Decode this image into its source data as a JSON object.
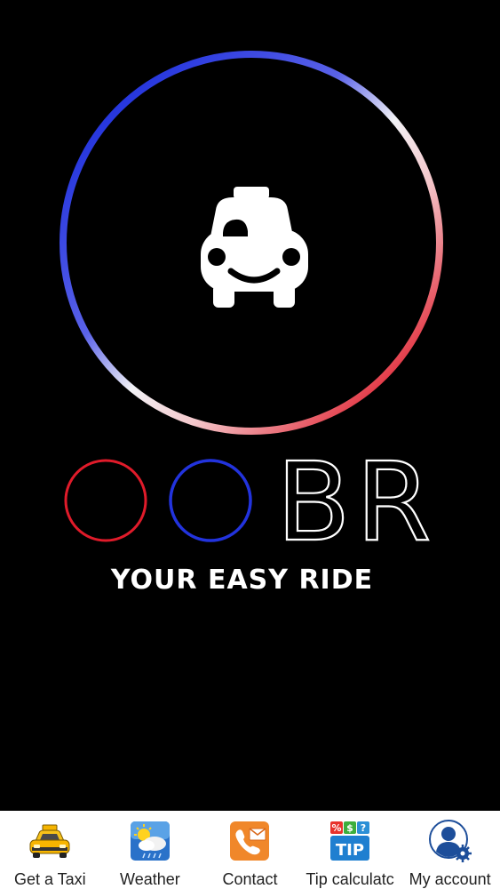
{
  "app": {
    "logo_letters": "BR",
    "slogan": "YOUR EASY RIDE"
  },
  "colors": {
    "background": "#000000",
    "ring_blue": "#2233dd",
    "ring_red": "#e01b2a",
    "logo_white": "#ffffff",
    "tabbar_background": "#ffffff"
  },
  "tabbar": {
    "items": [
      {
        "label": "Get a Taxi",
        "icon": "taxi-icon"
      },
      {
        "label": "Weather",
        "icon": "weather-icon"
      },
      {
        "label": "Contact",
        "icon": "contact-icon"
      },
      {
        "label": "Tip calculatc",
        "icon": "tip-calculator-icon"
      },
      {
        "label": "My account",
        "icon": "account-icon"
      }
    ]
  }
}
